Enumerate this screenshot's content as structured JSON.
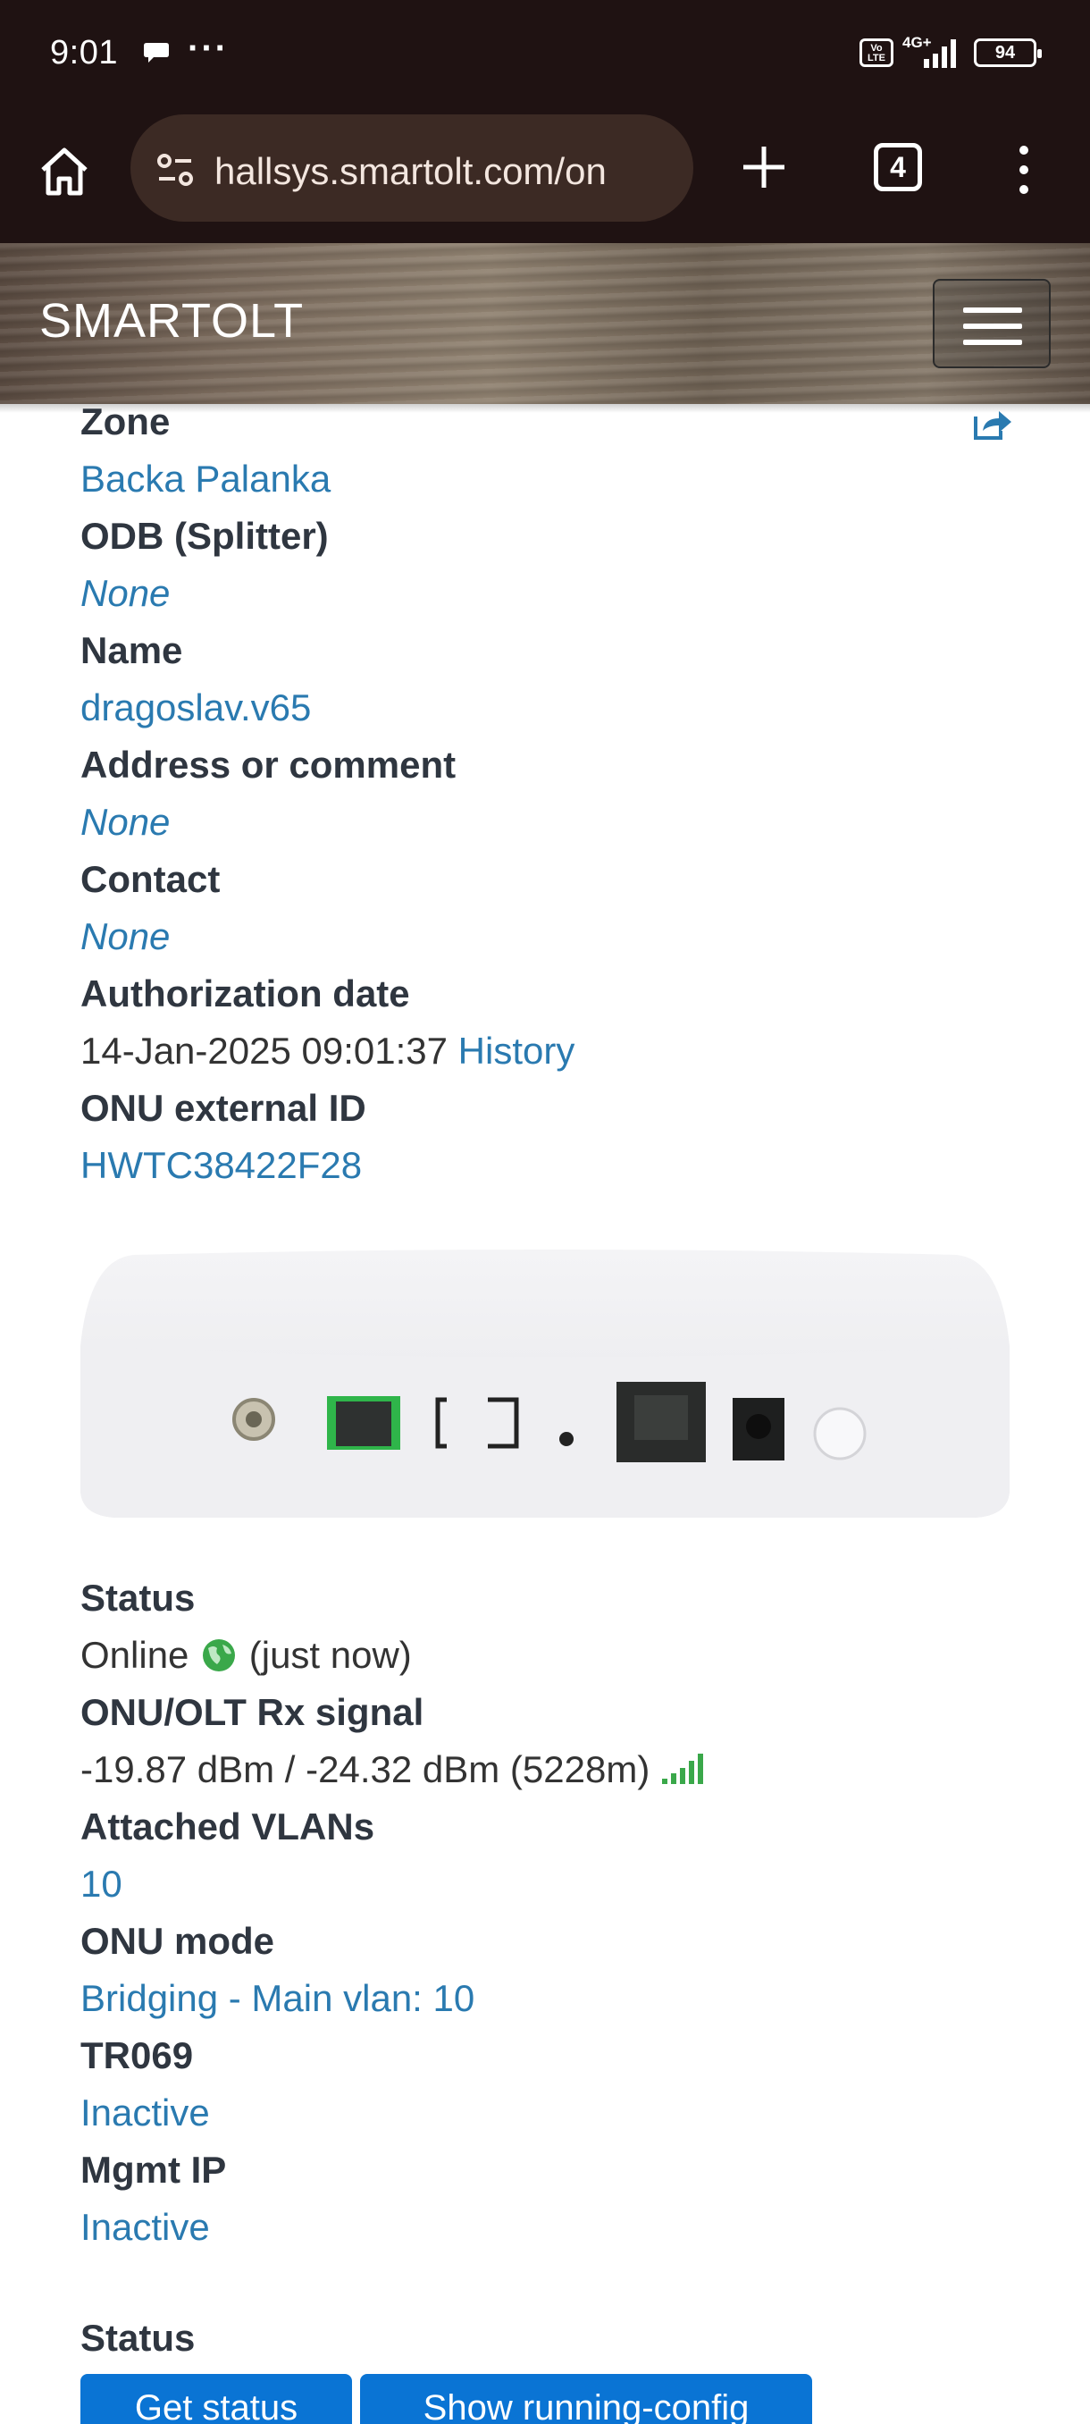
{
  "status_bar": {
    "time": "9:01",
    "more": "···",
    "volte": "Vo LTE",
    "network": "4G+",
    "battery": "94"
  },
  "browser": {
    "url": "hallsys.smartolt.com/on",
    "tab_count": "4"
  },
  "site": {
    "brand": "SMARTOLT"
  },
  "details": {
    "zone_label": "Zone",
    "zone_value": "Backa Palanka",
    "odb_label": "ODB (Splitter)",
    "odb_value": "None",
    "name_label": "Name",
    "name_value": "dragoslav.v65",
    "address_label": "Address or comment",
    "address_value": "None",
    "contact_label": "Contact",
    "contact_value": "None",
    "auth_label": "Authorization date",
    "auth_value": "14-Jan-2025 09:01:37",
    "auth_history": "History",
    "extid_label": "ONU external ID",
    "extid_value": "HWTC38422F28"
  },
  "status": {
    "status_label": "Status",
    "status_value": "Online",
    "status_time": "(just now)",
    "signal_label": "ONU/OLT Rx signal",
    "signal_value": "-19.87 dBm / -24.32 dBm (5228m)",
    "vlans_label": "Attached VLANs",
    "vlans_value": "10",
    "mode_label": "ONU mode",
    "mode_value": "Bridging - Main vlan: 10",
    "tr069_label": "TR069",
    "tr069_value": "Inactive",
    "mgmt_label": "Mgmt IP",
    "mgmt_value": "Inactive"
  },
  "actions": {
    "section_title": "Status",
    "get_status": "Get status",
    "show_running": "Show running-config"
  },
  "colors": {
    "link": "#2a7ab0",
    "label": "#2f3640",
    "button": "#0a74d4",
    "online_green": "#3aa84a",
    "chrome_bg": "#1f1212"
  }
}
